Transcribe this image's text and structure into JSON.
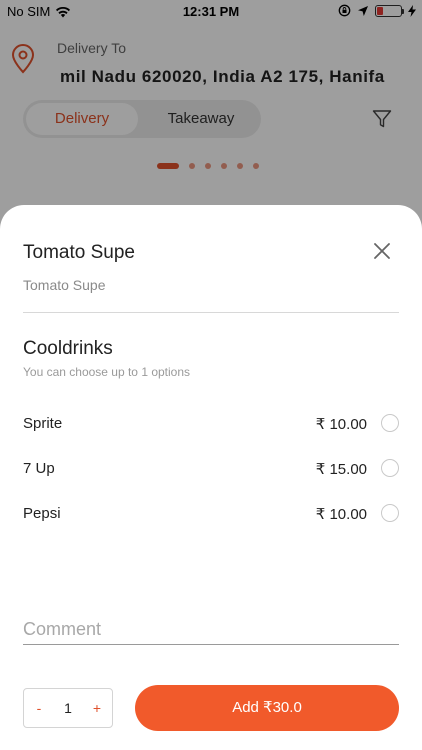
{
  "status_bar": {
    "carrier": "No SIM",
    "time": "12:31 PM"
  },
  "header": {
    "delivery_label": "Delivery To",
    "address": "mil Nadu 620020, India  A2 175, Hanifa"
  },
  "order_type": {
    "options": [
      "Delivery",
      "Takeaway"
    ],
    "selected": "Delivery"
  },
  "carousel": {
    "pages": 6,
    "active_index": 0
  },
  "sheet": {
    "item_title": "Tomato Supe",
    "item_description": "Tomato Supe",
    "group": {
      "title": "Cooldrinks",
      "hint": "You can choose up to 1 options",
      "options": [
        {
          "name": "Sprite",
          "price": "₹ 10.00"
        },
        {
          "name": "7 Up",
          "price": "₹ 15.00"
        },
        {
          "name": "Pepsi",
          "price": "₹ 10.00"
        }
      ]
    },
    "comment_placeholder": "Comment",
    "quantity": {
      "minus": "-",
      "value": "1",
      "plus": "+"
    },
    "add_button": "Add ₹30.0"
  },
  "colors": {
    "accent": "#f15a2b",
    "overlay": "rgba(0,0,0,0.38)"
  }
}
